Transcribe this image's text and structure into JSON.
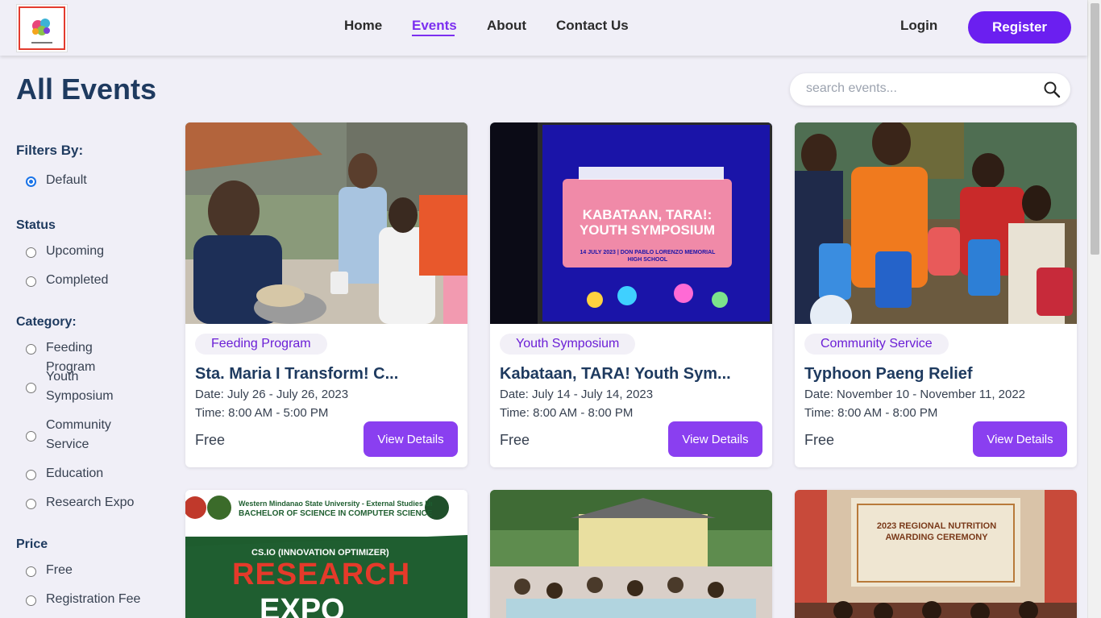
{
  "nav": {
    "items": [
      {
        "label": "Home",
        "active": false
      },
      {
        "label": "Events",
        "active": true
      },
      {
        "label": "About",
        "active": false
      },
      {
        "label": "Contact Us",
        "active": false
      }
    ],
    "login_label": "Login",
    "register_label": "Register",
    "accent_color": "#6b1ff0"
  },
  "page": {
    "title": "All Events",
    "search_placeholder": "search events..."
  },
  "sidebar": {
    "filters_title": "Filters By:",
    "default_label": "Default",
    "status_title": "Status",
    "status_options": [
      "Upcoming",
      "Completed"
    ],
    "category_title": "Category:",
    "category_options": [
      "Feeding Program",
      "Youth Symposium",
      "Community Service",
      "Education",
      "Research Expo"
    ],
    "price_title": "Price",
    "price_options": [
      "Free",
      "Registration Fee"
    ]
  },
  "events": [
    {
      "category": "Feeding Program",
      "title": "Sta. Maria I Transform! C...",
      "date": "Date: July 26 - July 26, 2023",
      "time": "Time: 8:00 AM - 5:00 PM",
      "price": "Free",
      "button": "View Details"
    },
    {
      "category": "Youth Symposium",
      "title": "Kabataan, TARA! Youth Sym...",
      "date": "Date: July 14 - July 14, 2023",
      "time": "Time: 8:00 AM - 8:00 PM",
      "price": "Free",
      "button": "View Details",
      "image_text": {
        "headline": "KABATAAN, TARA!: YOUTH SYMPOSIUM",
        "subline": "14 JULY 2023 | DON PABLO LORENZO MEMORIAL HIGH SCHOOL"
      }
    },
    {
      "category": "Community Service",
      "title": "Typhoon Paeng Relief",
      "date": "Date: November 10 - November 11, 2022",
      "time": "Time: 8:00 AM - 8:00 PM",
      "price": "Free",
      "button": "View Details"
    }
  ],
  "preview_images": [
    {
      "university": "Western Mindanao State University - External Studies Unit",
      "program": "BACHELOR OF SCIENCE IN COMPUTER SCIENCE",
      "event": "CS.IO (INNOVATION OPTIMIZER)",
      "headline": "RESEARCH",
      "headline2": "EXPO"
    },
    {},
    {
      "headline": "2023 REGIONAL NUTRITION AWARDING CEREMONY"
    }
  ]
}
